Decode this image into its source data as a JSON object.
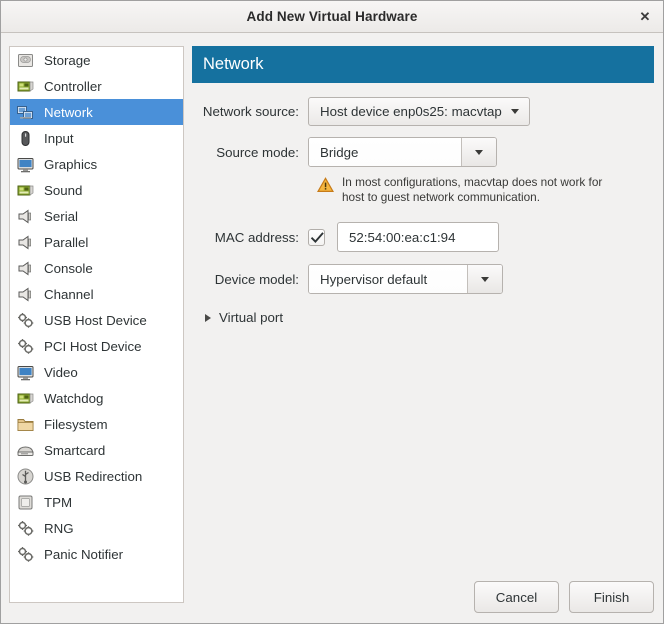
{
  "window": {
    "title": "Add New Virtual Hardware",
    "close_label": "✕",
    "close_icon": "close-icon"
  },
  "sidebar": {
    "items": [
      {
        "label": "Storage",
        "icon": "storage-drive-icon",
        "selected": false
      },
      {
        "label": "Controller",
        "icon": "controller-card-icon",
        "selected": false
      },
      {
        "label": "Network",
        "icon": "network-icon",
        "selected": true
      },
      {
        "label": "Input",
        "icon": "mouse-icon",
        "selected": false
      },
      {
        "label": "Graphics",
        "icon": "monitor-icon",
        "selected": false
      },
      {
        "label": "Sound",
        "icon": "sound-card-icon",
        "selected": false
      },
      {
        "label": "Serial",
        "icon": "serial-port-icon",
        "selected": false
      },
      {
        "label": "Parallel",
        "icon": "parallel-port-icon",
        "selected": false
      },
      {
        "label": "Console",
        "icon": "console-port-icon",
        "selected": false
      },
      {
        "label": "Channel",
        "icon": "channel-port-icon",
        "selected": false
      },
      {
        "label": "USB Host Device",
        "icon": "usb-host-gears-icon",
        "selected": false
      },
      {
        "label": "PCI Host Device",
        "icon": "pci-host-gears-icon",
        "selected": false
      },
      {
        "label": "Video",
        "icon": "video-monitor-icon",
        "selected": false
      },
      {
        "label": "Watchdog",
        "icon": "watchdog-card-icon",
        "selected": false
      },
      {
        "label": "Filesystem",
        "icon": "folder-icon",
        "selected": false
      },
      {
        "label": "Smartcard",
        "icon": "smartcard-reader-icon",
        "selected": false
      },
      {
        "label": "USB Redirection",
        "icon": "usb-plug-icon",
        "selected": false
      },
      {
        "label": "TPM",
        "icon": "chip-icon",
        "selected": false
      },
      {
        "label": "RNG",
        "icon": "rng-gears-icon",
        "selected": false
      },
      {
        "label": "Panic Notifier",
        "icon": "panic-gears-icon",
        "selected": false
      }
    ]
  },
  "panel": {
    "header": "Network",
    "network_source": {
      "label": "Network source:",
      "value": "Host device enp0s25: macvtap"
    },
    "source_mode": {
      "label": "Source mode:",
      "value": "Bridge"
    },
    "warning": {
      "icon": "warning-triangle-icon",
      "text": "In most configurations, macvtap does not work for host to guest network communication."
    },
    "mac_address": {
      "label": "MAC address:",
      "checked": true,
      "value": "52:54:00:ea:c1:94"
    },
    "device_model": {
      "label": "Device model:",
      "value": "Hypervisor default"
    },
    "virtual_port": {
      "label": "Virtual port",
      "expanded": false
    }
  },
  "footer": {
    "cancel_label": "Cancel",
    "finish_label": "Finish"
  },
  "colors": {
    "header_blue": "#15719f",
    "selection_blue": "#4a90d9",
    "warning_amber": "#f0a030",
    "dialog_bg": "#f2f1f0"
  }
}
